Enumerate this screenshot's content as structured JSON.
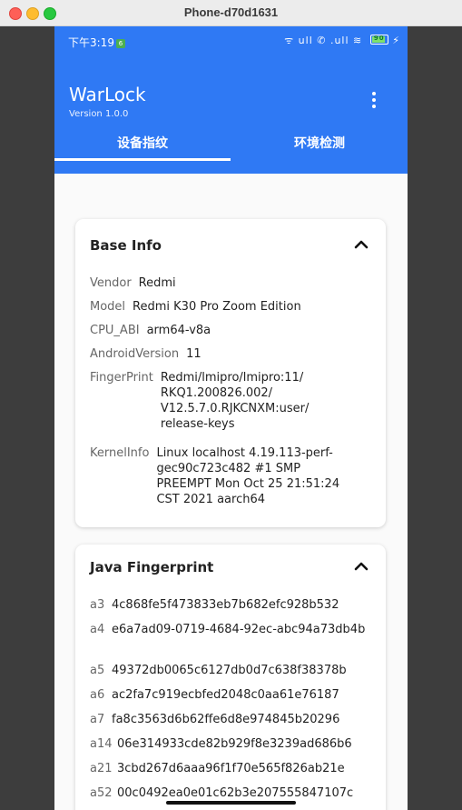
{
  "window": {
    "title": "Phone-d70d1631"
  },
  "status_bar": {
    "time": "下午3:19",
    "icons_text": "ᯤ ull ✆ .ull ≋",
    "battery": "90",
    "charging": "⚡"
  },
  "app": {
    "title": "WarLock",
    "version": "Version 1.0.0"
  },
  "tabs": [
    {
      "label": "设备指纹",
      "active": true
    },
    {
      "label": "环境检测",
      "active": false
    }
  ],
  "base_info": {
    "title": "Base Info",
    "rows": [
      {
        "key": "Vendor",
        "value": "Redmi"
      },
      {
        "key": "Model",
        "value": "Redmi K30 Pro Zoom Edition"
      },
      {
        "key": "CPU_ABI",
        "value": "arm64-v8a"
      },
      {
        "key": "AndroidVersion",
        "value": "11"
      },
      {
        "key": "FingerPrint",
        "value": "Redmi/lmipro/lmipro:11/ RKQ1.200826.002/ V12.5.7.0.RJKCNXM:user/ release-keys"
      },
      {
        "key": "KernelInfo",
        "value": "Linux localhost 4.19.113-perf-gec90c723c482 #1 SMP PREEMPT Mon Oct 25 21:51:24 CST 2021 aarch64"
      }
    ]
  },
  "java_fingerprint": {
    "title": "Java Fingerprint",
    "rows": [
      {
        "key": "a3",
        "value": "4c868fe5f473833eb7b682efc928b532"
      },
      {
        "key": "a4",
        "value": "e6a7ad09-0719-4684-92ec-abc94a73db4b"
      },
      {
        "key": "a5",
        "value": "49372db0065c6127db0d7c638f38378b"
      },
      {
        "key": "a6",
        "value": "ac2fa7c919ecbfed2048c0aa61e76187"
      },
      {
        "key": "a7",
        "value": "fa8c3563d6b62ffe6d8e974845b20296"
      },
      {
        "key": "a14",
        "value": "06e314933cde82b929f8e3239ad686b6"
      },
      {
        "key": "a21",
        "value": "3cbd267d6aaa96f1f70e565f826ab21e"
      },
      {
        "key": "a52",
        "value": "00c0492ea0e01c62b3e207555847107c"
      }
    ]
  },
  "colors": {
    "primary": "#2f79f4",
    "window_bg": "#3d3d3d"
  }
}
